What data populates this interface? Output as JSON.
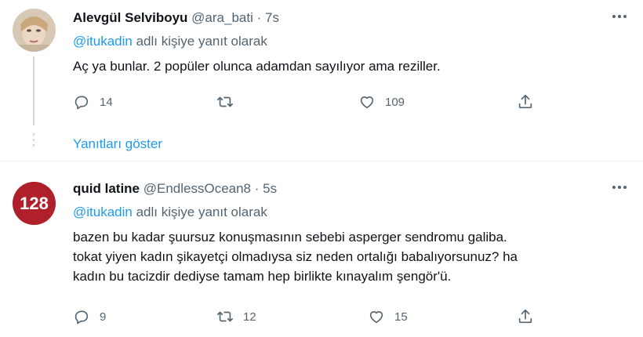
{
  "tweets": [
    {
      "author_name": "Alevgül Selviboyu",
      "author_handle": "@ara_bati",
      "separator": "·",
      "time": "7s",
      "replying_prefix": "",
      "replying_handle": "@itukadin",
      "replying_suffix": "adlı kişiye yanıt olarak",
      "text": "Aç ya bunlar. 2 popüler olunca adamdan sayılıyor ama reziller.",
      "replies": "14",
      "retweets": "",
      "likes": "109"
    },
    {
      "author_name": "quid latine",
      "author_handle": "@EndlessOcean8",
      "separator": "·",
      "time": "5s",
      "avatar_text": "128",
      "replying_handle": "@itukadin",
      "replying_suffix": "adlı kişiye yanıt olarak",
      "text_lines": [
        "bazen bu kadar şuursuz konuşmasının sebebi asperger sendromu galiba.",
        "tokat yiyen kadın şikayetçi olmadıysa siz neden ortalığı babalıyorsunuz? ha",
        "kadın bu tacizdir dediyse tamam hep birlikte kınayalım şengör'ü."
      ],
      "replies": "9",
      "retweets": "12",
      "likes": "15"
    }
  ],
  "show_replies": "Yanıtları göster",
  "colors": {
    "accent": "#1d9bf0",
    "secondary_text": "#536471",
    "avatar2_bg": "#b0202b"
  },
  "icons": [
    "more-icon",
    "reply-icon",
    "retweet-icon",
    "like-icon",
    "share-icon"
  ]
}
